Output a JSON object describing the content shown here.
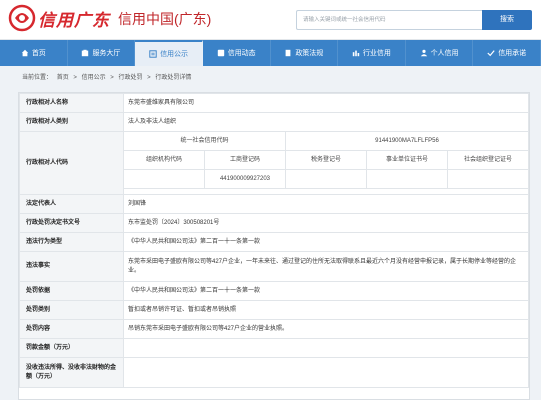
{
  "header": {
    "site_title": "信用广东",
    "site_subtitle": "信用中国(广东)",
    "search_placeholder": "请输入关键词或统一社会信用代码",
    "search_button": "搜索",
    "logo_icon": "credit-seal-logo"
  },
  "nav": {
    "items": [
      {
        "label": "首页",
        "icon": "home-icon"
      },
      {
        "label": "服务大厅",
        "icon": "service-icon"
      },
      {
        "label": "信用公示",
        "icon": "publicity-icon",
        "active": true
      },
      {
        "label": "信用动态",
        "icon": "news-icon"
      },
      {
        "label": "政策法规",
        "icon": "policy-icon"
      },
      {
        "label": "行业信用",
        "icon": "industry-icon"
      },
      {
        "label": "个人信用",
        "icon": "person-icon"
      },
      {
        "label": "信用承诺",
        "icon": "promise-icon"
      }
    ],
    "bg_color": "#3a82c8"
  },
  "breadcrumb": {
    "prefix": "当前位置：",
    "items": [
      "首页",
      ">",
      "信用公示",
      ">",
      "行政处罚",
      ">",
      "行政处罚详情"
    ]
  },
  "record": {
    "party_name_label": "行政相对人名称",
    "party_name": "东莞市盛维家具有限公司",
    "party_type_label": "行政相对人类别",
    "party_type": "法人及非法人组织",
    "party_code_label": "行政相对人代码",
    "usc_code_label": "统一社会信用代码",
    "usc_code": "91441900MA7LFLFP56",
    "sub_headers": [
      "组织机构代码",
      "工商登记码",
      "税务登记号",
      "事业单位证书号",
      "社会组织登记证号"
    ],
    "sub_values": [
      "",
      "441900009927203",
      "",
      "",
      ""
    ],
    "legal_rep_label": "法定代表人",
    "legal_rep": "刘国锋",
    "decision_no_label": "行政处罚决定书文号",
    "decision_no": "东市监处罚〔2024〕300508201号",
    "violation_type_label": "违法行为类型",
    "violation_type": "《中华人民共和国公司法》第二百一十一条第一款",
    "facts_label": "违法事实",
    "facts": "东莞市采田电子盛欧有限公司等427户企业，一年未来往、通过登记的住所无法取得联系且最近六个月没有经营申报记录，属于长期停业等经营的企业。",
    "basis_label": "处罚依据",
    "basis": "《中华人民共和国公司法》第二百一十一条第一款",
    "category_label": "处罚类别",
    "category": "暂扣或者吊销许可证、暂扣或者吊销执照",
    "content_label": "处罚内容",
    "content": "吊销东莞市采田电子盛欧有限公司等427户企业的营业执照。",
    "fine_label": "罚款金额（万元）",
    "fine": "",
    "confiscation_label": "没收违法所得、没收非法财物的金额（万元）",
    "confiscation": ""
  }
}
